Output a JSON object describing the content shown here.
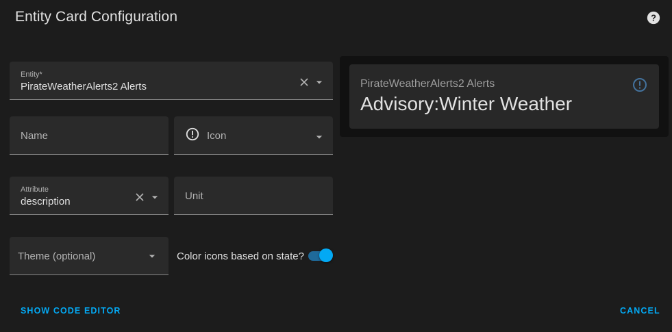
{
  "dialog": {
    "title": "Entity Card Configuration",
    "help_icon": "help-circle-icon"
  },
  "form": {
    "entity": {
      "label": "Entity*",
      "value": "PirateWeatherAlerts2 Alerts"
    },
    "name": {
      "placeholder": "Name"
    },
    "icon": {
      "placeholder": "Icon",
      "leading_icon": "alert-circle-outline-icon"
    },
    "attribute": {
      "label": "Attribute",
      "value": "description"
    },
    "unit": {
      "placeholder": "Unit"
    },
    "theme": {
      "placeholder": "Theme (optional)"
    },
    "color_icons": {
      "label": "Color icons based on state?",
      "enabled": true
    }
  },
  "preview": {
    "card": {
      "name": "PirateWeatherAlerts2 Alerts",
      "state": "Advisory:Winter Weather",
      "icon": "alert-circle-outline-icon"
    }
  },
  "actions": {
    "show_code_editor": "SHOW CODE EDITOR",
    "cancel": "CANCEL"
  },
  "colors": {
    "accent": "#03a9f4",
    "background": "#1c1c1c",
    "field": "#2a2a2a",
    "card": "#282828",
    "card_icon": "#44739e"
  }
}
